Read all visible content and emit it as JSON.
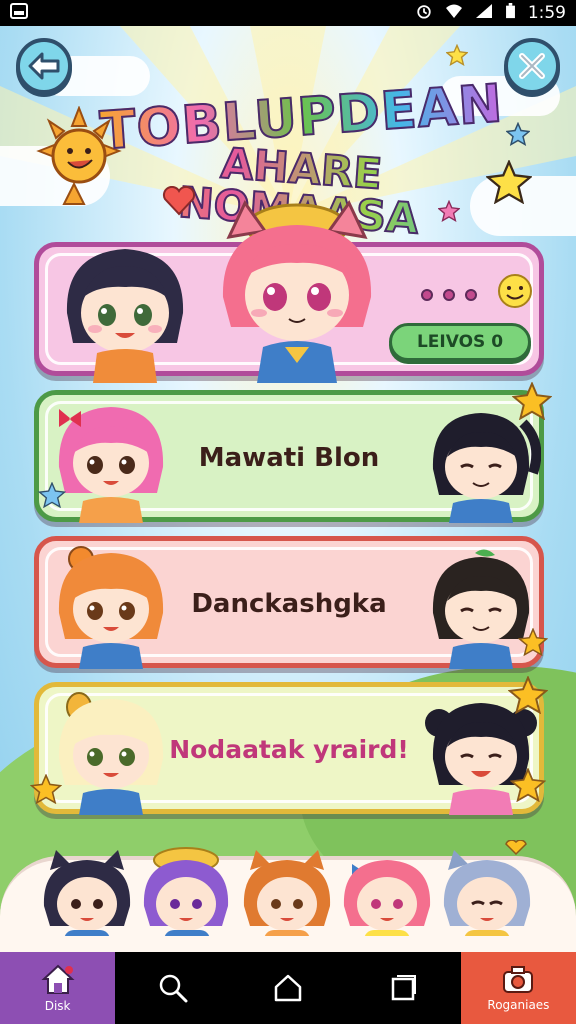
{
  "status_bar": {
    "time": "1:59"
  },
  "title": {
    "line1": "TOBLUPDEAN",
    "line2": "AHARE NOMAASA"
  },
  "cards": [
    {
      "button_label": "LEIVOS 0"
    },
    {
      "name": "Mawati Blon"
    },
    {
      "name": "Danckashgka"
    },
    {
      "name": "Nodaatak yraird!"
    }
  ],
  "nav": {
    "left_label": "Disk",
    "right_label": "Roganiaes"
  },
  "colors": {
    "card1": "#f7c6e4",
    "card1_border": "#b04c9a",
    "card2": "#d8f2c4",
    "card2_border": "#4d9a46",
    "card3": "#fbd4d2",
    "card3_border": "#d6564c",
    "card4": "#eef6c6",
    "card4_border": "#e2b93a"
  },
  "icons": [
    "back-arrow-icon",
    "close-icon",
    "sun-icon",
    "heart-icon",
    "star-icon",
    "search-icon",
    "home-icon",
    "recents-icon",
    "camera-icon"
  ]
}
